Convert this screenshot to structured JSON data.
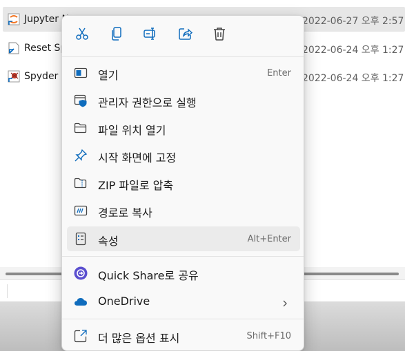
{
  "files": [
    {
      "name": "Jupyter N",
      "date": "2022-06-27 오후 2:57",
      "selected": true,
      "icon": "jupyter-shortcut-icon"
    },
    {
      "name": "Reset Sp",
      "date": "2022-06-24 오후 1:27",
      "selected": false,
      "icon": "reset-shortcut-icon"
    },
    {
      "name": "Spyder (",
      "date": "2022-06-24 오후 1:27",
      "selected": false,
      "icon": "spyder-shortcut-icon"
    }
  ],
  "quick_actions": [
    {
      "name": "cut",
      "icon": "scissors-icon"
    },
    {
      "name": "copy",
      "icon": "copy-icon"
    },
    {
      "name": "rename",
      "icon": "rename-icon"
    },
    {
      "name": "share",
      "icon": "share-icon"
    },
    {
      "name": "delete",
      "icon": "trash-icon"
    }
  ],
  "menu": {
    "open": {
      "label": "열기",
      "shortcut": "Enter",
      "icon": "open-window-icon"
    },
    "run_as_admin": {
      "label": "관리자 권한으로 실행",
      "icon": "shield-icon"
    },
    "open_file_location": {
      "label": "파일 위치 열기",
      "icon": "folder-icon"
    },
    "pin_to_start": {
      "label": "시작 화면에 고정",
      "icon": "pin-icon"
    },
    "compress_zip": {
      "label": "ZIP 파일로 압축",
      "icon": "zip-folder-icon"
    },
    "copy_as_path": {
      "label": "경로로 복사",
      "icon": "copy-path-icon"
    },
    "properties": {
      "label": "속성",
      "shortcut": "Alt+Enter",
      "icon": "properties-icon"
    },
    "quick_share": {
      "label": "Quick Share로 공유",
      "icon": "quick-share-icon"
    },
    "onedrive": {
      "label": "OneDrive",
      "icon": "cloud-icon"
    },
    "show_more": {
      "label": "더 많은 옵션 표시",
      "shortcut": "Shift+F10",
      "icon": "expand-icon"
    }
  },
  "colors": {
    "accent": "#0067c0",
    "menu_bg": "#f9f9f9",
    "hover": "#ebebeb",
    "onedrive": "#0f6cbd",
    "quick_share": "#5b4fcf"
  }
}
